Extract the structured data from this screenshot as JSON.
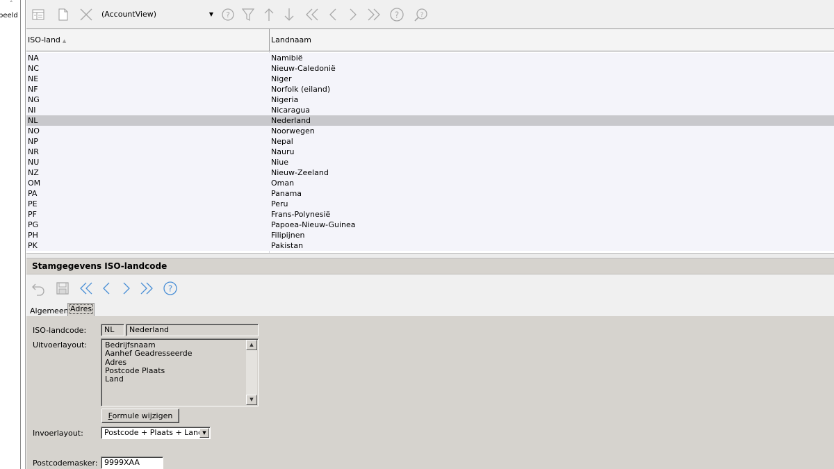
{
  "left_panel": {
    "label": "beeld",
    "chevron": "˄"
  },
  "toolbar": {
    "view_select": {
      "value": "(AccountView)"
    },
    "icons": [
      "grid-view-icon",
      "new-document-icon",
      "delete-icon",
      "search-help-icon",
      "filter-icon",
      "sort-ascending-icon",
      "sort-descending-icon",
      "first-record-icon",
      "previous-record-icon",
      "next-record-icon",
      "last-record-icon",
      "help-icon",
      "zoom-search-icon"
    ]
  },
  "grid": {
    "columns": [
      "ISO-land",
      "Landnaam"
    ],
    "sort_indicator": "▲",
    "rows": [
      {
        "code": "NA",
        "name": "Namibië",
        "selected": false
      },
      {
        "code": "NC",
        "name": "Nieuw-Caledonië",
        "selected": false
      },
      {
        "code": "NE",
        "name": "Niger",
        "selected": false
      },
      {
        "code": "NF",
        "name": "Norfolk (eiland)",
        "selected": false
      },
      {
        "code": "NG",
        "name": "Nigeria",
        "selected": false
      },
      {
        "code": "NI",
        "name": "Nicaragua",
        "selected": false
      },
      {
        "code": "NL",
        "name": "Nederland",
        "selected": true
      },
      {
        "code": "NO",
        "name": "Noorwegen",
        "selected": false
      },
      {
        "code": "NP",
        "name": "Nepal",
        "selected": false
      },
      {
        "code": "NR",
        "name": "Nauru",
        "selected": false
      },
      {
        "code": "NU",
        "name": "Niue",
        "selected": false
      },
      {
        "code": "NZ",
        "name": "Nieuw-Zeeland",
        "selected": false
      },
      {
        "code": "OM",
        "name": "Oman",
        "selected": false
      },
      {
        "code": "PA",
        "name": "Panama",
        "selected": false
      },
      {
        "code": "PE",
        "name": "Peru",
        "selected": false
      },
      {
        "code": "PF",
        "name": "Frans-Polynesië",
        "selected": false
      },
      {
        "code": "PG",
        "name": "Papoea-Nieuw-Guinea",
        "selected": false
      },
      {
        "code": "PH",
        "name": "Filipijnen",
        "selected": false
      },
      {
        "code": "PK",
        "name": "Pakistan",
        "selected": false
      }
    ]
  },
  "detail": {
    "title": "Stamgegevens ISO-landcode",
    "toolbar_icons": [
      "undo-icon",
      "save-icon",
      "first-record-icon",
      "previous-record-icon",
      "next-record-icon",
      "last-record-icon",
      "help-icon"
    ],
    "tabs": [
      "Algemeen",
      "Adres"
    ],
    "active_tab": "Adres",
    "fields": {
      "iso_label": "ISO-landcode:",
      "iso_code": "NL",
      "iso_name": "Nederland",
      "uitvoer_label": "Uitvoerlayout:",
      "uitvoer_lines": [
        "Bedrijfsnaam",
        "Aanhef Geadresseerde",
        "Adres",
        "Postcode Plaats",
        "Land"
      ],
      "formule_button_first": "F",
      "formule_button_rest": "ormule wijzigen",
      "invoer_label": "Invoerlayout:",
      "invoer_value": "Postcode + Plaats + Land",
      "postcode_label": "Postcodemasker:",
      "postcode_value": "9999XAA"
    }
  }
}
